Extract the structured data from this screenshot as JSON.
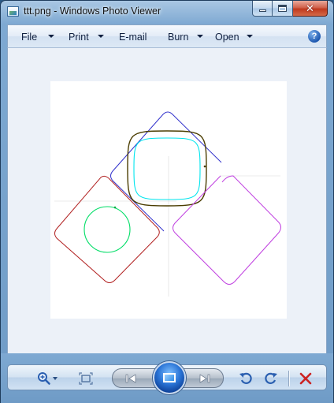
{
  "window": {
    "title": "ttt.png - Windows Photo Viewer",
    "app_icon": "photo-viewer-icon",
    "caption_buttons": [
      {
        "name": "minimize",
        "icon": "minimize-icon"
      },
      {
        "name": "maximize",
        "icon": "maximize-icon"
      },
      {
        "name": "close",
        "icon": "close-icon",
        "glyph": "✕"
      }
    ]
  },
  "menu": {
    "items": [
      {
        "label": "File",
        "has_dropdown": true
      },
      {
        "label": "Print",
        "has_dropdown": true
      },
      {
        "label": "E-mail",
        "has_dropdown": false
      },
      {
        "label": "Burn",
        "has_dropdown": true
      },
      {
        "label": "Open",
        "has_dropdown": true
      }
    ],
    "help_icon": "help-icon",
    "help_glyph": "?"
  },
  "image": {
    "background": "#ffffff",
    "curves": [
      {
        "name": "blue-rounded-diamond",
        "color": "#3333cc"
      },
      {
        "name": "olive-rounded-square",
        "color": "#4a3c00"
      },
      {
        "name": "cyan-rounded-square",
        "color": "#00e5ee"
      },
      {
        "name": "red-rounded-diamond",
        "color": "#b22222"
      },
      {
        "name": "green-circle",
        "color": "#00dd66"
      },
      {
        "name": "magenta-rounded-diamond",
        "color": "#c040e0"
      }
    ],
    "axis_color": "#d0d0d0"
  },
  "toolbar": {
    "buttons": [
      {
        "name": "zoom",
        "icon": "magnifier-icon"
      },
      {
        "name": "actual-size",
        "icon": "actual-size-icon"
      },
      {
        "name": "previous",
        "icon": "previous-icon"
      },
      {
        "name": "slideshow",
        "icon": "slideshow-icon"
      },
      {
        "name": "next",
        "icon": "next-icon"
      },
      {
        "name": "rotate-counterclockwise",
        "icon": "rotate-ccw-icon"
      },
      {
        "name": "rotate-clockwise",
        "icon": "rotate-cw-icon"
      },
      {
        "name": "delete",
        "icon": "delete-icon"
      }
    ],
    "accent_color": "#2a5fb0",
    "delete_color": "#cc2222"
  }
}
